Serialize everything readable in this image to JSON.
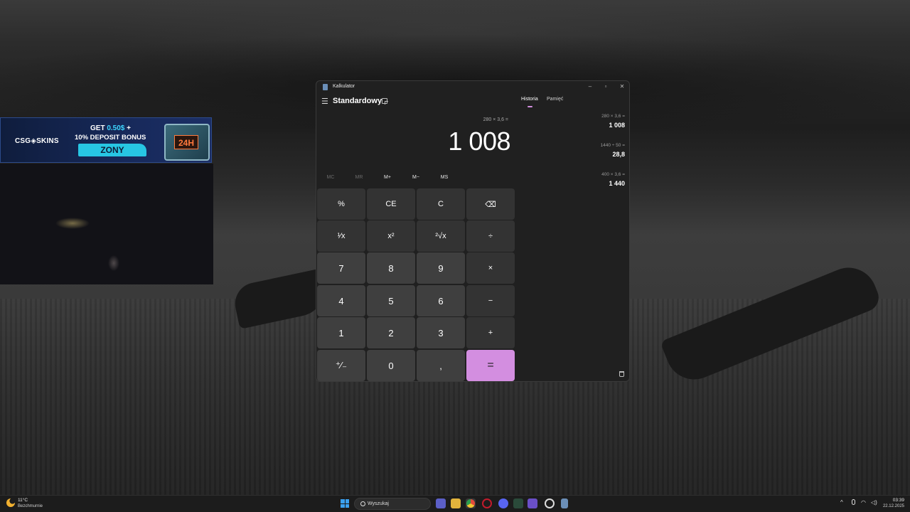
{
  "ad": {
    "logo": "CSG◈SKINS",
    "line1_prefix": "GET ",
    "line1_highlight": "0.50$",
    "line1_suffix": " +",
    "line2": "10% DEPOSIT BONUS",
    "code": "ZONY",
    "box_label": "24H"
  },
  "calculator": {
    "window_title": "Kalkulator",
    "mode": "Standardowy",
    "expression": "280 × 3,6 =",
    "display": "1 008",
    "memory_buttons": [
      "MC",
      "MR",
      "M+",
      "M−",
      "MS"
    ],
    "tabs": {
      "history": "Historia",
      "memory": "Pamięć"
    },
    "keys": {
      "percent": "%",
      "ce": "CE",
      "c": "C",
      "backspace": "⌫",
      "reciprocal": "¹⁄x",
      "square": "x²",
      "sqrt": "²√x",
      "divide": "÷",
      "seven": "7",
      "eight": "8",
      "nine": "9",
      "multiply": "×",
      "four": "4",
      "five": "5",
      "six": "6",
      "minus": "−",
      "one": "1",
      "two": "2",
      "three": "3",
      "plus": "+",
      "negate": "⁺⁄₋",
      "zero": "0",
      "decimal": ",",
      "equals": "="
    },
    "history": [
      {
        "expression": "280   ×   3,6 =",
        "result": "1 008"
      },
      {
        "expression": "1440   ÷   50 =",
        "result": "28,8"
      },
      {
        "expression": "400   ×   3,6 =",
        "result": "1 440"
      }
    ]
  },
  "taskbar": {
    "weather_temp": "11°C",
    "weather_desc": "Bezchmurnie",
    "search_placeholder": "Wyszukaj",
    "time": "03:39",
    "date": "22.12.2025"
  },
  "colors": {
    "accent": "#d38ee0",
    "window_bg": "#202020",
    "key_bg": "#3b3b3b"
  }
}
